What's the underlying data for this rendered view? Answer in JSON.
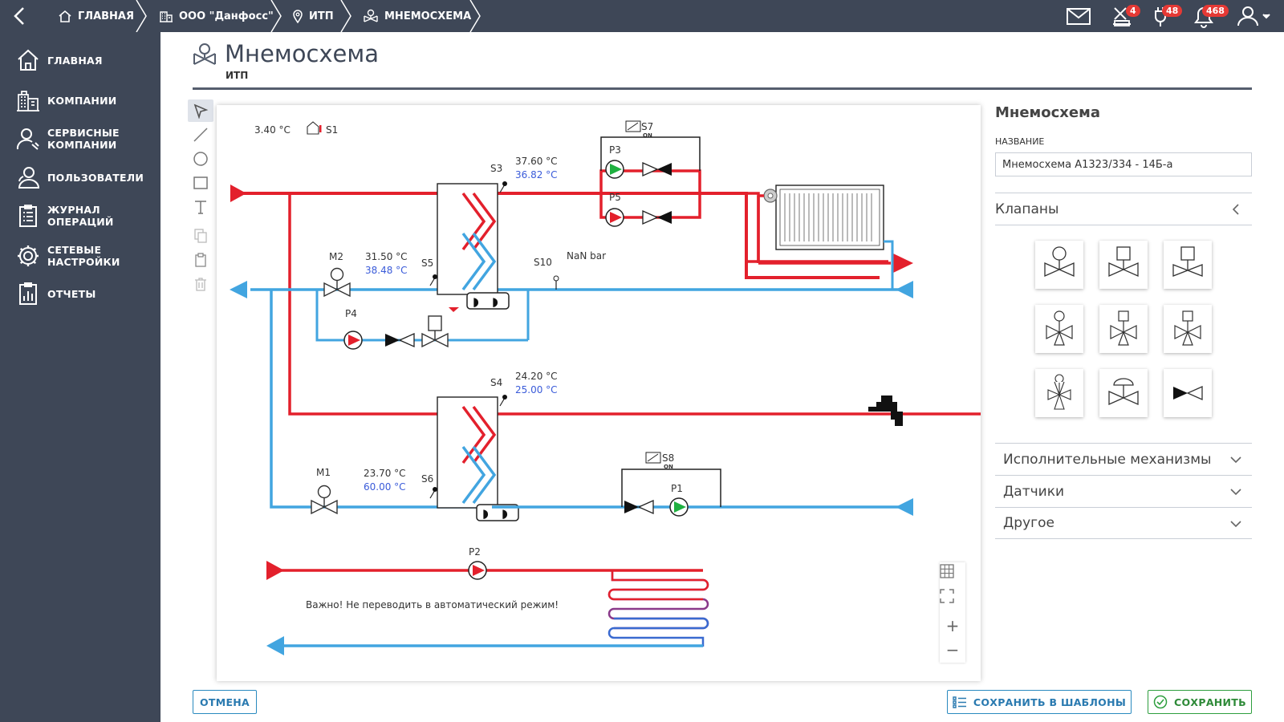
{
  "breadcrumbs": [
    {
      "label": "ГЛАВНАЯ",
      "icon": "home-icon"
    },
    {
      "label": "ООО \"Данфосс\"",
      "icon": "building-icon"
    },
    {
      "label": "ИТП",
      "icon": "location-pin-icon"
    },
    {
      "label": "МНЕМОСХЕМА",
      "icon": "mnemoscheme-icon"
    }
  ],
  "top_icons": [
    {
      "name": "mail-icon",
      "badge": ""
    },
    {
      "name": "tools-icon",
      "badge": "4"
    },
    {
      "name": "plug-icon",
      "badge": "48"
    },
    {
      "name": "bell-icon",
      "badge": "468"
    },
    {
      "name": "user-icon",
      "badge": ""
    }
  ],
  "sidebar": {
    "items": [
      {
        "label": "ГЛАВНАЯ",
        "icon": "home-icon"
      },
      {
        "label": "КОМПАНИИ",
        "icon": "buildings-icon"
      },
      {
        "label": "СЕРВИСНЫЕ\nКОМПАНИИ",
        "icon": "service-user-icon"
      },
      {
        "label": "ПОЛЬЗОВАТЕЛИ",
        "icon": "users-icon"
      },
      {
        "label": "ЖУРНАЛ\nОПЕРАЦИЙ",
        "icon": "journal-icon"
      },
      {
        "label": "СЕТЕВЫЕ\nНАСТРОЙКИ",
        "icon": "gear-icon"
      },
      {
        "label": "ОТЧЕТЫ",
        "icon": "report-chart-icon"
      }
    ]
  },
  "page": {
    "title": "Мнемосхема",
    "subtitle": "ИТП"
  },
  "tools": [
    "select-arrow-icon",
    "line-tool-icon",
    "circle-tool-icon",
    "rectangle-tool-icon",
    "text-tool-icon",
    "copy-icon",
    "paste-icon",
    "trash-icon"
  ],
  "canvas": {
    "s1": {
      "value": "3.40 °C",
      "label": "S1"
    },
    "s3": {
      "label": "S3",
      "t1": "37.60 °C",
      "t2": "36.82 °C"
    },
    "s5": {
      "label": "S5",
      "t1": "31.50 °C",
      "t2": "38.48 °C"
    },
    "s10": {
      "label": "S10",
      "value": "NaN bar"
    },
    "s4": {
      "label": "S4",
      "t1": "24.20 °C",
      "t2": "25.00 °C"
    },
    "s6": {
      "label": "S6",
      "t1": "23.70 °C",
      "t2": "60.00 °C"
    },
    "s7": {
      "label": "S7",
      "state": "ON"
    },
    "s8": {
      "label": "S8",
      "state": "ON"
    },
    "m1": "M1",
    "m2": "M2",
    "p1": "P1",
    "p2": "P2",
    "p3": "P3",
    "p4": "P4",
    "p5": "P5",
    "note": "Важно! Не переводить в автоматический режим!"
  },
  "zoom": {
    "plus": "+",
    "minus": "−"
  },
  "panel": {
    "title": "Мнемосхема",
    "name_label": "НАЗВАНИЕ",
    "name_value": "Мнемосхема А1323/334 - 14Б-а",
    "sections": [
      {
        "label": "Клапаны",
        "expanded": true
      },
      {
        "label": "Исполнительные механизмы",
        "expanded": false
      },
      {
        "label": "Датчики",
        "expanded": false
      },
      {
        "label": "Другое",
        "expanded": false
      }
    ]
  },
  "buttons": {
    "cancel": "ОТМЕНА",
    "save_template": "СОХРАНИТЬ В ШАБЛОНЫ",
    "save": "СОХРАНИТЬ"
  },
  "colors": {
    "sidebar_bg": "#3e4757",
    "hot_pipe": "#e3202c",
    "cold_pipe": "#42a5e0",
    "accent": "#2a8abf",
    "save_green": "#2e9e3e"
  }
}
